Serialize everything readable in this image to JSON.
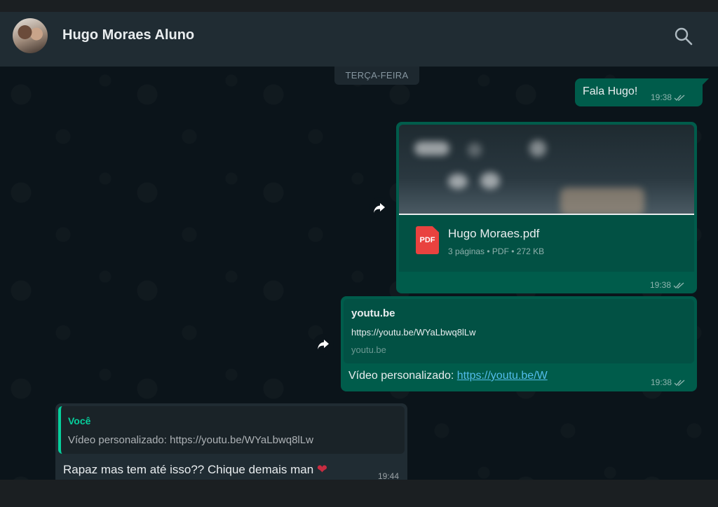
{
  "header": {
    "contact_name": "Hugo Moraes Aluno",
    "icons": {
      "avatar": "contact-avatar",
      "search": "search-icon"
    }
  },
  "chat": {
    "day_label": "TERÇA-FEIRA",
    "messages": [
      {
        "type": "text",
        "direction": "out",
        "text": "Fala Hugo!",
        "time": "19:38",
        "status": "read"
      },
      {
        "type": "document",
        "direction": "out",
        "file_name": "Hugo Moraes.pdf",
        "file_info": "3 páginas • PDF • 272 KB",
        "file_badge": "PDF",
        "time": "19:38",
        "status": "read"
      },
      {
        "type": "link",
        "direction": "out",
        "preview_title": "youtu.be",
        "preview_url": "https://youtu.be/WYaLbwq8lLw",
        "preview_domain": "youtu.be",
        "text_prefix": "Vídeo personalizado: ",
        "link_text": "https://youtu.be/W",
        "time": "19:38",
        "status": "read"
      },
      {
        "type": "reply",
        "direction": "in",
        "quoted_author": "Você",
        "quoted_text": "Vídeo personalizado: https://youtu.be/WYaLbwq8lLw",
        "text": "Rapaz mas tem até isso?? Chique demais man",
        "emoji": "❤",
        "time": "19:44"
      }
    ]
  },
  "colors": {
    "outgoing_bubble": "#005c4b",
    "incoming_bubble": "#202c33",
    "accent_green": "#06cf9c",
    "link_blue": "#53bdeb",
    "pdf_red": "#e9423f"
  }
}
